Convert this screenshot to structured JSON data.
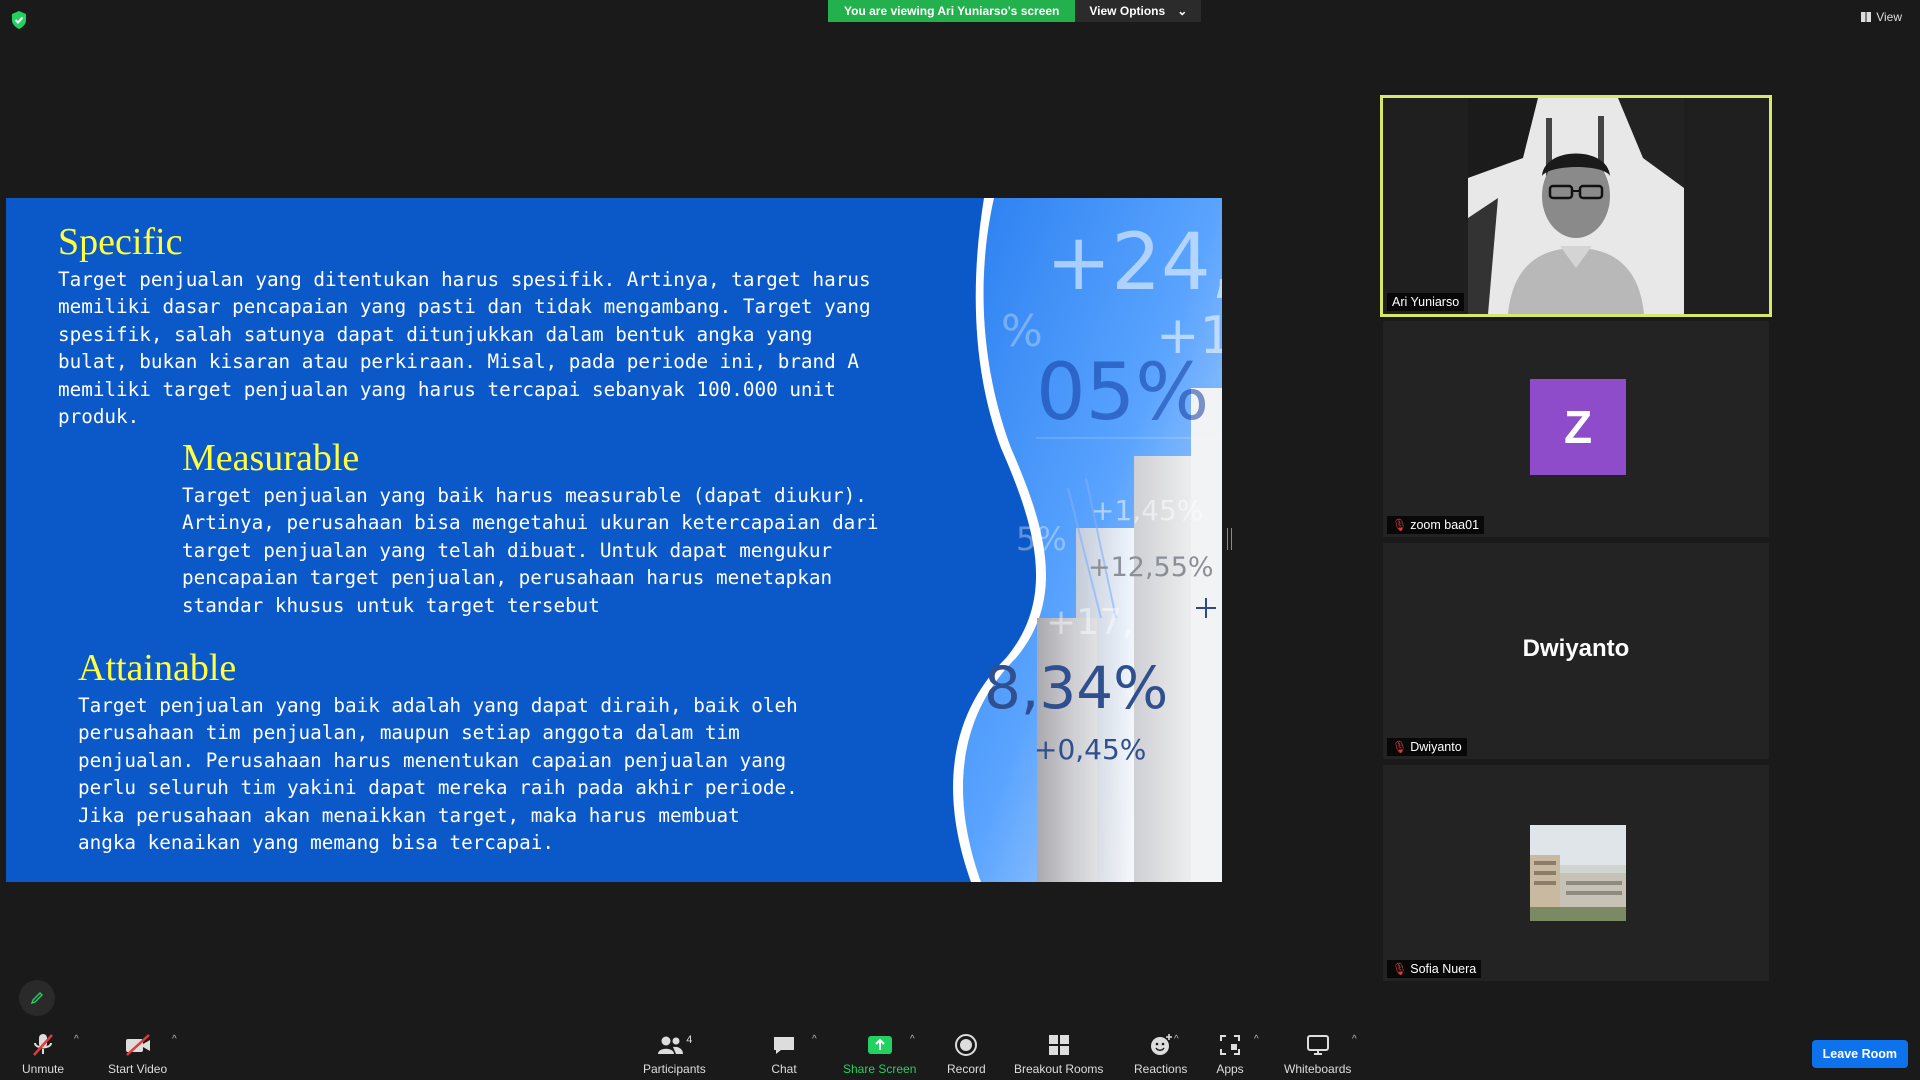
{
  "banner": {
    "viewing": "You are viewing Ari Yuniarso's screen",
    "view_options": "View Options"
  },
  "view_label": "View",
  "slide": {
    "specific_title": "Specific",
    "specific_body": "Target penjualan yang ditentukan harus spesifik. Artinya, target harus\nmemiliki dasar pencapaian yang pasti dan tidak mengambang. Target yang\nspesifik, salah satunya dapat ditunjukkan dalam bentuk angka yang\nbulat, bukan kisaran atau perkiraan. Misal, pada periode ini, brand A\nmemiliki target penjualan yang harus tercapai sebanyak 100.000 unit\nproduk.",
    "measurable_title": "Measurable",
    "measurable_body": "Target penjualan yang baik harus measurable (dapat diukur).\nArtinya, perusahaan bisa mengetahui ukuran ketercapaian dari\ntarget penjualan yang telah dibuat. Untuk dapat mengukur\npencapaian target penjualan, perusahaan harus menetapkan\nstandar khusus untuk target tersebut",
    "attainable_title": "Attainable",
    "attainable_body": "Target penjualan yang baik adalah yang dapat diraih, baik oleh\nperusahaan tim penjualan, maupun setiap anggota dalam tim\npenjualan. Perusahaan harus menentukan capaian penjualan yang\nperlu seluruh tim yakini dapat mereka raih pada akhir periode.\nJika perusahaan akan menaikkan target, maka harus membuat\nangka kenaikan yang memang bisa tercapai.",
    "deco": {
      "n1": "+24,",
      "n2": "+1",
      "n3": "05%",
      "n4": "+1,45%",
      "n5": "+12,55%",
      "n6": "+17,",
      "n7": "8,34%",
      "n8": "+0,45%",
      "n9": "%",
      "n10": "5%"
    }
  },
  "participants_gallery": [
    {
      "name": "Ari  Yuniarso"
    },
    {
      "name": "zoom baa01",
      "initial": "Z"
    },
    {
      "name": "Dwiyanto",
      "display": "Dwiyanto"
    },
    {
      "name": "Sofia Nuera"
    }
  ],
  "toolbar": {
    "unmute": "Unmute",
    "start_video": "Start Video",
    "participants": "Participants",
    "participants_count": "4",
    "chat": "Chat",
    "share_screen": "Share Screen",
    "record": "Record",
    "breakout_rooms": "Breakout Rooms",
    "reactions": "Reactions",
    "apps": "Apps",
    "whiteboards": "Whiteboards",
    "leave": "Leave Room"
  },
  "colors": {
    "slide_blue": "#0b58c9",
    "heading_yellow": "#ffff3f",
    "active_speaker": "#d7e86a",
    "share_green": "#22b14c",
    "leave_blue": "#0e72ed",
    "avatar_purple": "#8e4ccb"
  }
}
